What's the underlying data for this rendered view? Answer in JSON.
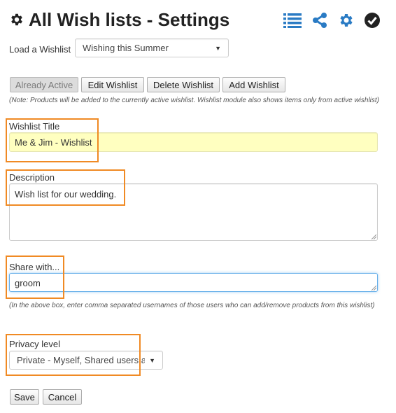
{
  "header": {
    "title": "All Wish lists - Settings"
  },
  "icons": {
    "title": "gear-icon",
    "list": "list-icon",
    "share": "share-icon",
    "settings": "gear-icon",
    "active": "check-circle-icon"
  },
  "colors": {
    "accent": "#2a7bc4",
    "highlight": "#f08a24",
    "title_field_bg": "#ffffc0"
  },
  "load": {
    "label": "Load a Wishlist",
    "selected": "Wishing this Summer"
  },
  "buttons": {
    "already_active": "Already Active",
    "edit": "Edit Wishlist",
    "delete": "Delete Wishlist",
    "add": "Add Wishlist"
  },
  "note_active": "(Note: Products will be added to the currently active wishlist. Wishlist module also shows items only from active wishlist)",
  "wishlist_title": {
    "label": "Wishlist Title",
    "value": "Me & Jim - Wishlist"
  },
  "description": {
    "label": "Description",
    "value": "Wish list for our wedding."
  },
  "share": {
    "label": "Share with...",
    "value": "groom",
    "note": "(In the above box, enter comma separated usernames of those users who can add/remove products from this wishlist)"
  },
  "privacy": {
    "label": "Privacy level",
    "selected": "Private - Myself, Shared users a"
  },
  "footer": {
    "save": "Save",
    "cancel": "Cancel"
  }
}
